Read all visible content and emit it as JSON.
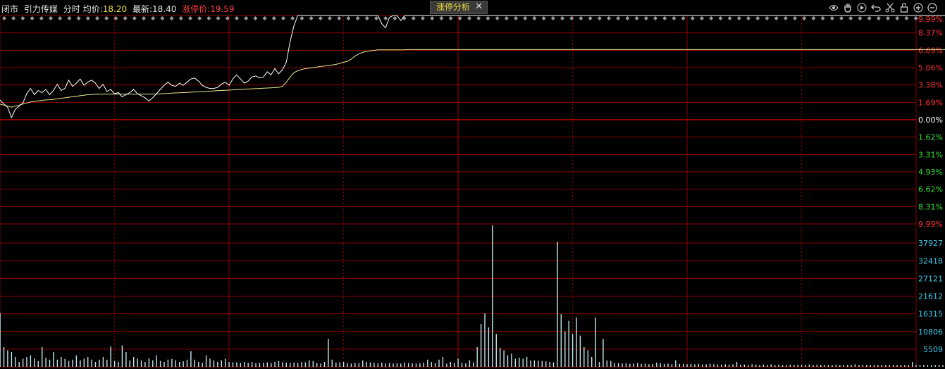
{
  "header": {
    "status": "闭市",
    "stock_name": "引力传媒",
    "mode": "分时",
    "avg_label": "均价:",
    "avg_value": "18.20",
    "last_label": "最新:",
    "last_value": "18.40",
    "limit_label": "涨停价:",
    "limit_value": "19.59"
  },
  "tab": {
    "label": "涨停分析",
    "close": "✕"
  },
  "toolbar": [
    "eye-icon",
    "hand-icon",
    "play-icon",
    "undo-icon",
    "scissors-icon",
    "lock-icon",
    "zoom-in-icon",
    "zoom-out-icon"
  ],
  "colors": {
    "price": "#ffffff",
    "avg": "#f0e68c",
    "volume": "#c0e8f0",
    "grid": "#8b0000",
    "up": "#ff3030",
    "down": "#30e030",
    "vol_axis": "#40c8e8"
  },
  "chart_data": [
    {
      "type": "line",
      "title": "",
      "y_right_ticks": [
        "9.99%",
        "8.37%",
        "6.69%",
        "5.06%",
        "3.38%",
        "1.69%",
        "0.00%",
        "1.62%",
        "3.31%",
        "4.93%",
        "6.62%",
        "8.31%",
        "9.99%"
      ],
      "ylim_pct": [
        -9.99,
        9.99
      ],
      "series": [
        {
          "values": [
            1.9,
            1.5,
            1.2,
            0.2,
            1.0,
            1.3,
            1.6,
            2.5,
            3.0,
            2.4,
            2.8,
            2.6,
            2.9,
            2.4,
            2.8,
            3.4,
            2.8,
            3.0,
            3.8,
            3.2,
            3.5,
            3.9,
            3.3,
            3.6,
            3.8,
            3.5,
            3.0,
            3.4,
            2.7,
            2.9,
            2.5,
            2.6,
            2.2,
            2.4,
            2.6,
            2.9,
            2.5,
            2.3,
            2.1,
            1.8,
            2.1,
            2.5,
            2.9,
            3.3,
            3.6,
            3.3,
            3.2,
            3.5,
            3.3,
            3.6,
            3.9,
            4.0,
            3.7,
            3.3,
            3.1,
            3.0,
            3.0,
            3.1,
            3.4,
            3.6,
            3.3,
            3.9,
            4.3,
            3.9,
            3.5,
            3.7,
            4.1,
            4.2,
            4.0,
            4.1,
            4.6,
            4.3,
            4.9,
            4.4,
            4.8,
            5.5,
            7.5,
            9.0,
            9.99,
            9.99,
            9.99,
            9.99,
            9.99,
            9.99,
            9.99,
            9.99,
            9.99,
            9.99,
            9.99,
            9.99,
            9.99,
            9.99,
            9.99,
            9.99,
            9.99,
            9.99,
            9.99,
            9.99,
            9.99,
            9.99,
            9.2,
            8.8,
            9.8,
            9.99,
            9.99,
            9.5,
            9.99,
            9.99,
            9.99,
            9.99,
            9.99,
            9.99,
            9.99,
            9.99,
            9.99,
            9.99,
            9.99,
            9.99,
            9.99,
            9.99,
            9.99,
            9.99,
            9.99,
            9.99,
            9.99,
            9.99,
            9.99,
            9.99,
            9.99,
            9.99,
            9.99,
            9.99,
            9.99,
            9.99,
            9.99,
            9.99,
            9.99,
            9.99,
            9.99,
            9.99,
            9.99,
            9.99,
            9.99,
            9.99,
            9.99,
            9.99,
            9.99,
            9.99,
            9.99,
            9.99,
            9.99,
            9.99,
            9.99,
            9.99,
            9.99,
            9.99,
            9.99,
            9.99,
            9.99,
            9.99,
            9.99,
            9.99,
            9.99,
            9.99,
            9.99,
            9.99,
            9.99,
            9.99,
            9.99,
            9.99,
            9.99,
            9.99,
            9.99,
            9.99,
            9.99,
            9.99,
            9.99,
            9.99,
            9.99,
            9.99,
            9.99,
            9.99,
            9.99,
            9.99,
            9.99,
            9.99,
            9.99,
            9.99,
            9.99,
            9.99,
            9.99,
            9.99,
            9.99,
            9.99,
            9.99,
            9.99,
            9.99,
            9.99,
            9.99,
            9.99,
            9.99,
            9.99,
            9.99,
            9.99,
            9.99,
            9.99,
            9.99,
            9.99,
            9.99,
            9.99,
            9.99,
            9.99,
            9.99,
            9.99,
            9.99,
            9.99,
            9.99,
            9.99,
            9.99,
            9.99,
            9.99,
            9.99,
            9.99,
            9.99,
            9.99,
            9.99,
            9.99,
            9.99,
            9.99,
            9.99,
            9.99,
            9.99,
            9.99,
            9.99,
            9.99,
            9.99,
            9.99,
            9.99,
            9.99,
            9.99,
            9.99,
            9.99,
            9.99,
            9.99,
            9.99,
            9.99,
            9.99,
            9.99,
            9.99,
            9.99,
            9.99,
            9.99,
            9.99,
            9.99,
            9.99,
            9.99,
            9.99,
            9.99
          ]
        },
        {
          "values": [
            1.5,
            1.4,
            1.3,
            1.2,
            1.3,
            1.4,
            1.5,
            1.6,
            1.7,
            1.75,
            1.8,
            1.85,
            1.9,
            1.92,
            1.95,
            2.0,
            2.05,
            2.1,
            2.15,
            2.2,
            2.25,
            2.3,
            2.35,
            2.4,
            2.42,
            2.44,
            2.45,
            2.46,
            2.46,
            2.46,
            2.46,
            2.46,
            2.46,
            2.46,
            2.46,
            2.46,
            2.46,
            2.46,
            2.46,
            2.46,
            2.46,
            2.47,
            2.48,
            2.5,
            2.52,
            2.55,
            2.57,
            2.58,
            2.6,
            2.62,
            2.64,
            2.66,
            2.68,
            2.7,
            2.72,
            2.74,
            2.76,
            2.78,
            2.8,
            2.82,
            2.84,
            2.86,
            2.88,
            2.9,
            2.92,
            2.94,
            2.96,
            2.98,
            3.0,
            3.02,
            3.04,
            3.06,
            3.08,
            3.1,
            3.2,
            3.6,
            4.1,
            4.5,
            4.7,
            4.8,
            4.9,
            4.95,
            5.0,
            5.05,
            5.1,
            5.15,
            5.2,
            5.25,
            5.3,
            5.4,
            5.5,
            5.6,
            5.8,
            6.1,
            6.3,
            6.45,
            6.55,
            6.6,
            6.65,
            6.7,
            6.7,
            6.7,
            6.7,
            6.7,
            6.7,
            6.7,
            6.7,
            6.72,
            6.72,
            6.72,
            6.72,
            6.72,
            6.72,
            6.72,
            6.72,
            6.72,
            6.72,
            6.72,
            6.72,
            6.72,
            6.72,
            6.72,
            6.72,
            6.72,
            6.72,
            6.72,
            6.72,
            6.72,
            6.72,
            6.72,
            6.72,
            6.72,
            6.72,
            6.72,
            6.72,
            6.72,
            6.72,
            6.72,
            6.72,
            6.72,
            6.72,
            6.72,
            6.72,
            6.72,
            6.72,
            6.72,
            6.72,
            6.72,
            6.72,
            6.72,
            6.72,
            6.72,
            6.72,
            6.72,
            6.72,
            6.72,
            6.72,
            6.72,
            6.72,
            6.72,
            6.72,
            6.72,
            6.72,
            6.72,
            6.72,
            6.72,
            6.72,
            6.72,
            6.72,
            6.72,
            6.72,
            6.72,
            6.72,
            6.72,
            6.72,
            6.72,
            6.72,
            6.72,
            6.72,
            6.72,
            6.72,
            6.72,
            6.72,
            6.72,
            6.72,
            6.72,
            6.72,
            6.72,
            6.72,
            6.72,
            6.72,
            6.72,
            6.72,
            6.72,
            6.72,
            6.72,
            6.72,
            6.72,
            6.72,
            6.72,
            6.72,
            6.72,
            6.72,
            6.72,
            6.72,
            6.72,
            6.72,
            6.72,
            6.72,
            6.72,
            6.72,
            6.72,
            6.72,
            6.72,
            6.72,
            6.72,
            6.72,
            6.72,
            6.72,
            6.72,
            6.72,
            6.72,
            6.72,
            6.72,
            6.72,
            6.72,
            6.72,
            6.72,
            6.72,
            6.72,
            6.72,
            6.72,
            6.72,
            6.72,
            6.72,
            6.72,
            6.72,
            6.72,
            6.72,
            6.72,
            6.72,
            6.72,
            6.72,
            6.72,
            6.72,
            6.72,
            6.72,
            6.72,
            6.72,
            6.72,
            6.72
          ]
        }
      ]
    },
    {
      "type": "bar",
      "title": "",
      "y_right_ticks": [
        "37927",
        "32418",
        "27121",
        "21612",
        "16315",
        "10806",
        "5509"
      ],
      "ylim": [
        0,
        43000
      ],
      "values": [
        16315,
        6000,
        5000,
        4500,
        3000,
        1500,
        2500,
        3000,
        3500,
        2500,
        1800,
        6000,
        2800,
        2200,
        4500,
        2200,
        3000,
        2400,
        1800,
        2200,
        3500,
        2000,
        2500,
        3000,
        2200,
        1500,
        2200,
        3000,
        2200,
        6200,
        1800,
        1500,
        6500,
        4500,
        2000,
        3000,
        2500,
        2000,
        1500,
        2600,
        2000,
        3500,
        1800,
        1500,
        2200,
        2400,
        2000,
        1500,
        1700,
        2200,
        4800,
        2200,
        1500,
        1200,
        3500,
        2500,
        2000,
        1500,
        2000,
        2500,
        1500,
        1400,
        1400,
        1200,
        1500,
        1200,
        1500,
        1100,
        1200,
        1300,
        1400,
        1200,
        1500,
        1800,
        1500,
        1300,
        1200,
        1300,
        1200,
        1500,
        1400,
        2000,
        1800,
        1200,
        1000,
        1500,
        8500,
        2200,
        1300,
        1400,
        1500,
        1200,
        1000,
        1200,
        1200,
        2000,
        1500,
        1400,
        1200,
        1100,
        1300,
        1000,
        1200,
        1000,
        1100,
        1000,
        1400,
        1200,
        1100,
        1000,
        1100,
        1300,
        2200,
        1500,
        1200,
        2200,
        3000,
        1000,
        1500,
        1200,
        2500,
        1200,
        1100,
        2000,
        1400,
        6000,
        13000,
        16315,
        12000,
        46000,
        10000,
        5800,
        5000,
        3500,
        4000,
        2500,
        2800,
        2500,
        3000,
        2000,
        2000,
        1900,
        1800,
        1700,
        1500,
        1400,
        38000,
        16000,
        10806,
        14000,
        10000,
        15000,
        9500,
        6000,
        5000,
        3000,
        15000,
        1500,
        8500,
        2000,
        1800,
        1200,
        1200,
        1000,
        1100,
        900,
        1000,
        1200,
        900,
        1000,
        800,
        900,
        1300,
        1100,
        900,
        1000,
        800,
        2000,
        900,
        900,
        800,
        900,
        800,
        900,
        700,
        800,
        900,
        800,
        700,
        700,
        800,
        700,
        800,
        1500,
        700,
        700,
        600,
        800,
        700,
        600,
        700,
        600,
        800,
        600,
        700,
        600,
        600,
        700,
        600,
        700,
        600,
        600,
        700,
        600,
        700,
        600,
        600,
        600,
        600,
        700,
        600,
        600,
        600,
        600,
        800,
        600,
        600,
        600,
        600,
        600,
        600,
        600,
        600,
        600,
        600,
        600,
        600,
        600,
        600,
        1500,
        600,
        600,
        600,
        600,
        600,
        600,
        600,
        600,
        600,
        600,
        1800,
        3500
      ]
    }
  ]
}
